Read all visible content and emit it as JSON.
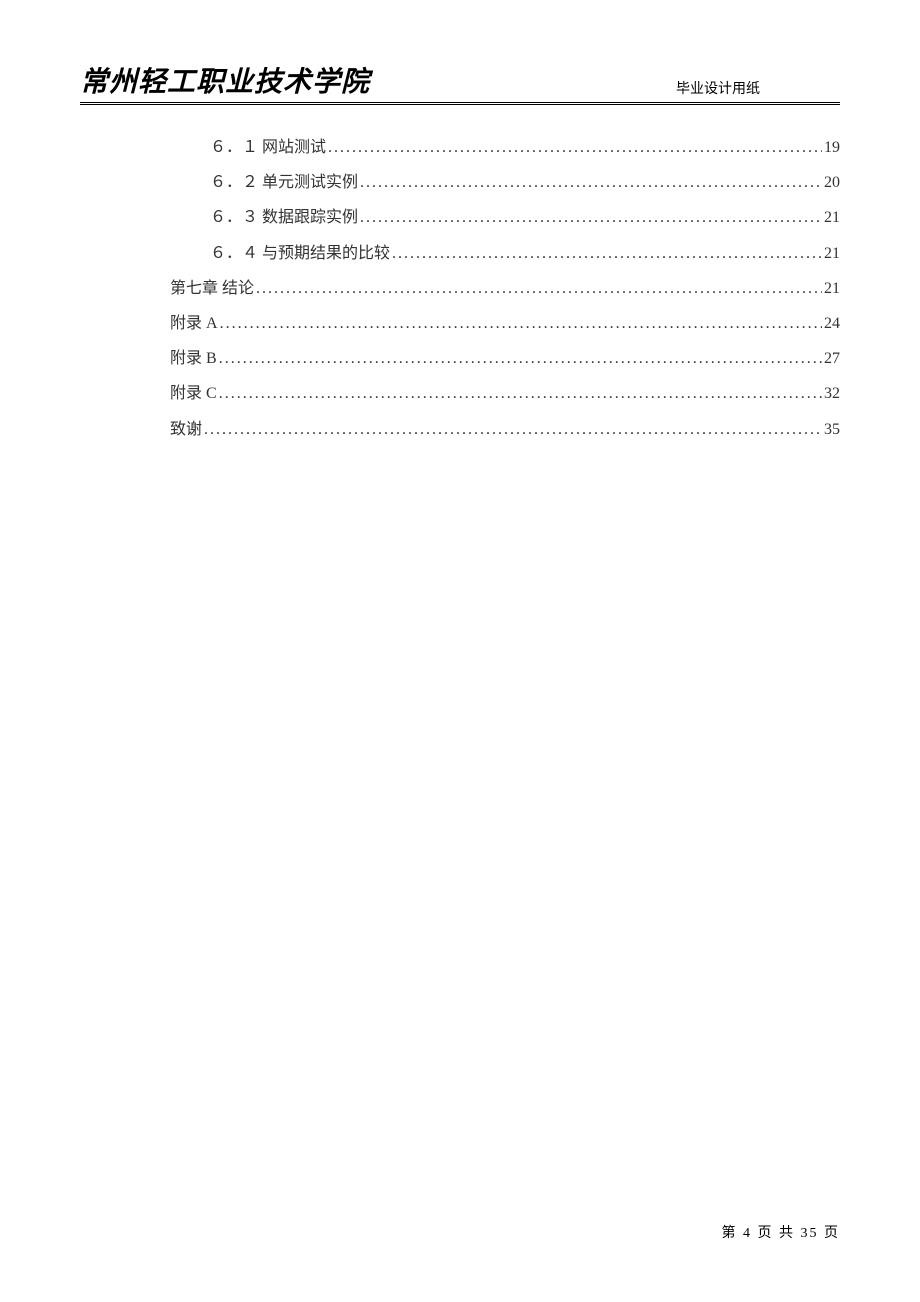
{
  "header": {
    "school_name": "常州轻工职业技术学院",
    "paper_type": "毕业设计用纸"
  },
  "toc": [
    {
      "level": 2,
      "label": "６．１ 网站测试 ",
      "page": "19"
    },
    {
      "level": 2,
      "label": "６．２ 单元测试实例 ",
      "page": "20"
    },
    {
      "level": 2,
      "label": "６．３ 数据跟踪实例 ",
      "page": "21"
    },
    {
      "level": 2,
      "label": "６．４ 与预期结果的比较 ",
      "page": "21"
    },
    {
      "level": 1,
      "label": "第七章  结论 ",
      "page": "21"
    },
    {
      "level": 1,
      "label": "附录 A ",
      "page": "24"
    },
    {
      "level": 1,
      "label": "附录 B ",
      "page": "27"
    },
    {
      "level": 1,
      "label": "附录 C ",
      "page": "32"
    },
    {
      "level": 1,
      "label": "致谢 ",
      "page": "35"
    }
  ],
  "footer": {
    "prefix": "第",
    "current": "4",
    "mid": "页 共",
    "total": "35",
    "suffix": "页"
  }
}
